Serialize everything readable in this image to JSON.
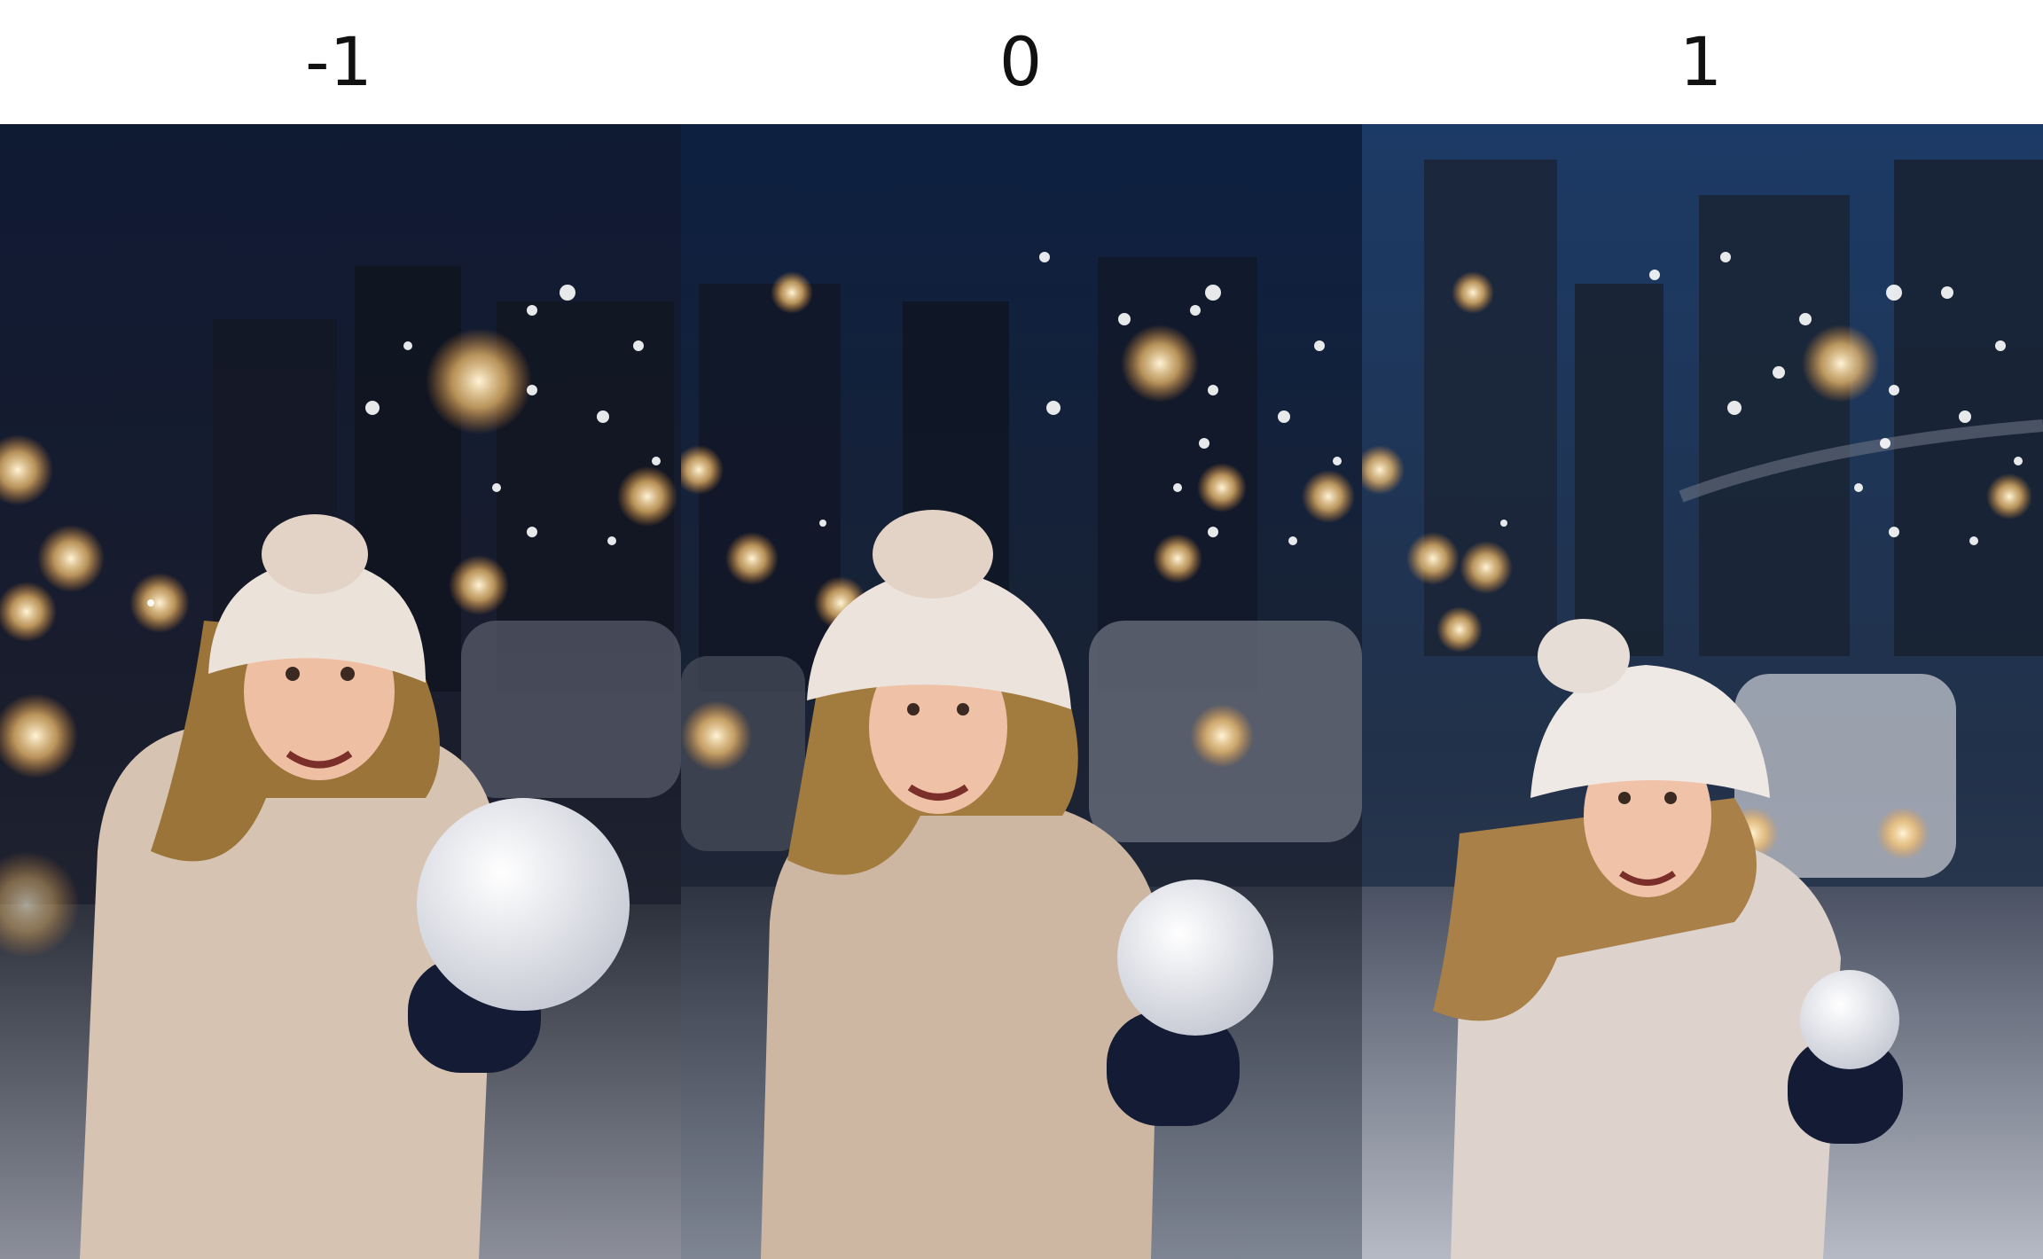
{
  "labels": [
    "-1",
    "0",
    "1"
  ],
  "panels": [
    {
      "name": "panel-minus-1",
      "label": "-1",
      "sky": "#141c34",
      "coat": "#d6c3b2",
      "hat": "#ebe2da",
      "hair": "#9a7438"
    },
    {
      "name": "panel-0",
      "label": "0",
      "sky": "#10203e",
      "coat": "#cdb7a3",
      "hat": "#ece3dc",
      "hair": "#a27c3f"
    },
    {
      "name": "panel-plus-1",
      "label": "1",
      "sky": "#203a5e",
      "coat": "#ddd2cc",
      "hat": "#efe9e5",
      "hair": "#a88048"
    }
  ]
}
